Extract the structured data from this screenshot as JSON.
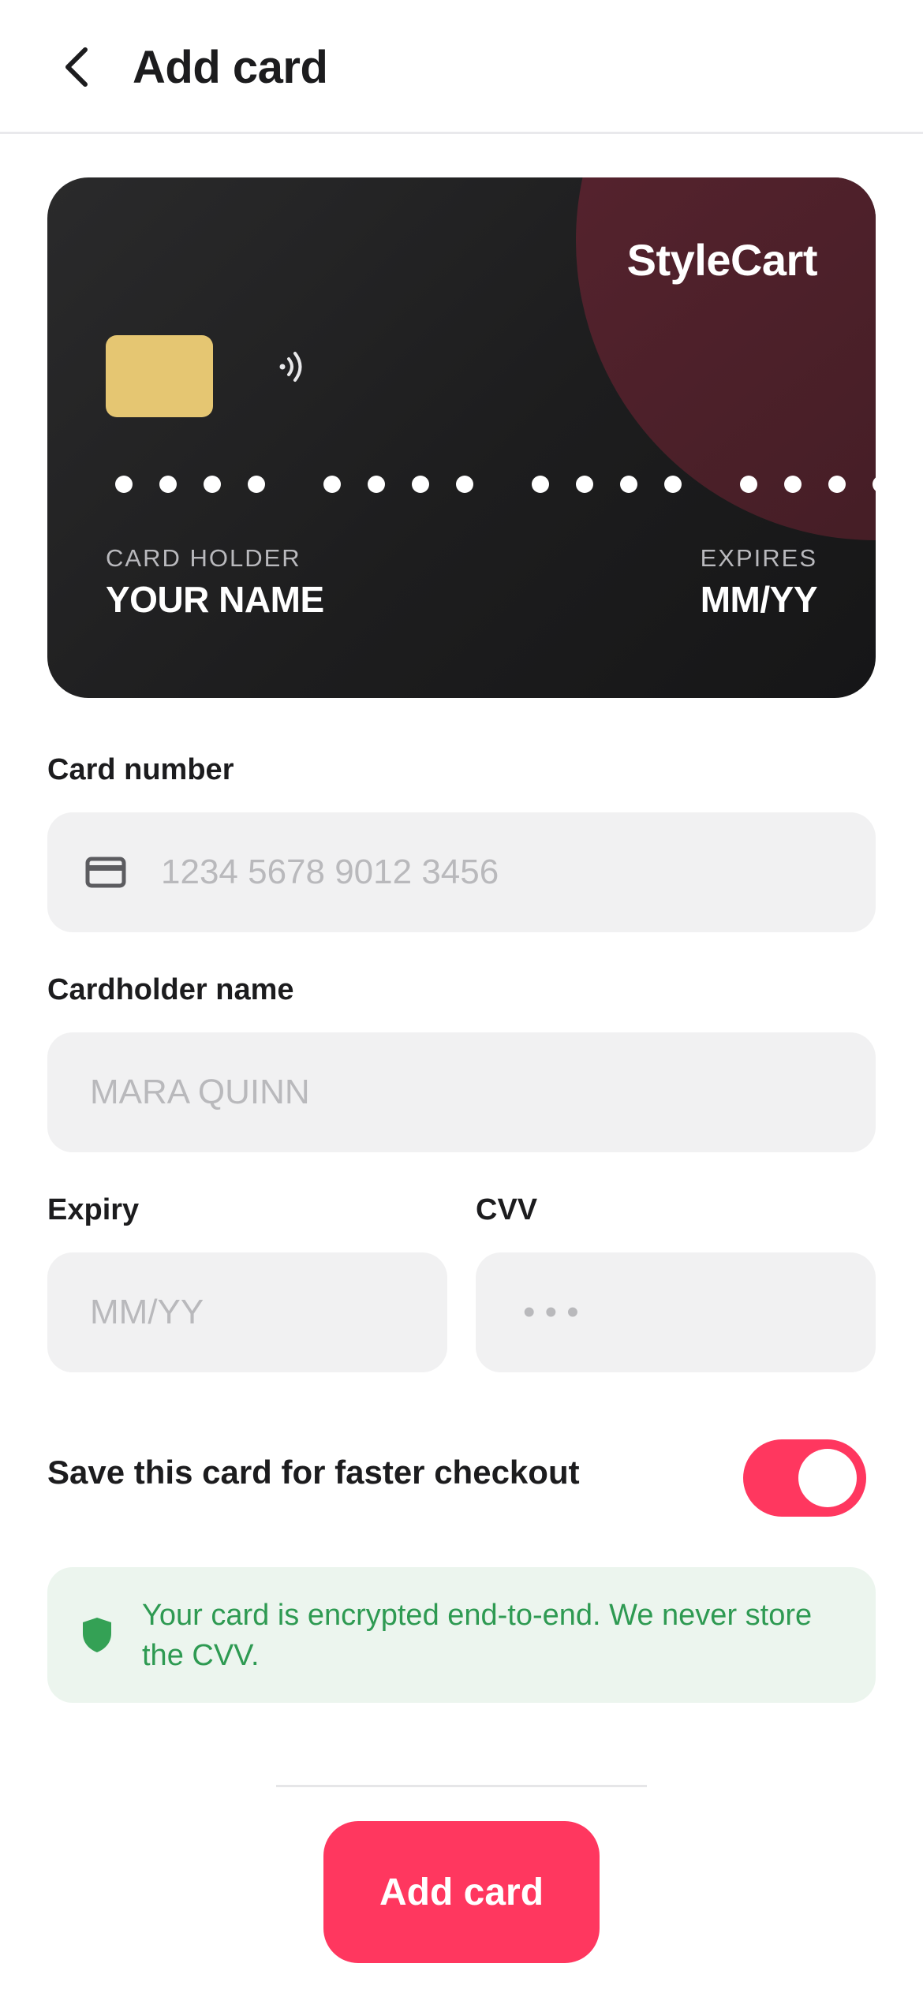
{
  "header": {
    "title": "Add card"
  },
  "card_preview": {
    "brand": "StyleCart",
    "holder_label": "CARD HOLDER",
    "holder_value": "YOUR NAME",
    "expires_label": "EXPIRES",
    "expires_value": "MM/YY",
    "chip_color": "#e5c672",
    "accent_color": "#4a1f28"
  },
  "form": {
    "card_number": {
      "label": "Card number",
      "placeholder": "1234 5678 9012 3456",
      "value": ""
    },
    "cardholder_name": {
      "label": "Cardholder name",
      "placeholder": "MARA QUINN",
      "value": ""
    },
    "expiry": {
      "label": "Expiry",
      "placeholder": "MM/YY",
      "value": ""
    },
    "cvv": {
      "label": "CVV",
      "placeholder": "• • •",
      "value": ""
    }
  },
  "save_card": {
    "label": "Save this card for faster checkout",
    "enabled": true
  },
  "security_notice": {
    "text": "Your card is encrypted end-to-end. We never store the CVV."
  },
  "actions": {
    "submit_label": "Add card"
  },
  "colors": {
    "primary": "#ff375f",
    "success": "#2e9a52",
    "field_bg": "#f1f1f2"
  }
}
